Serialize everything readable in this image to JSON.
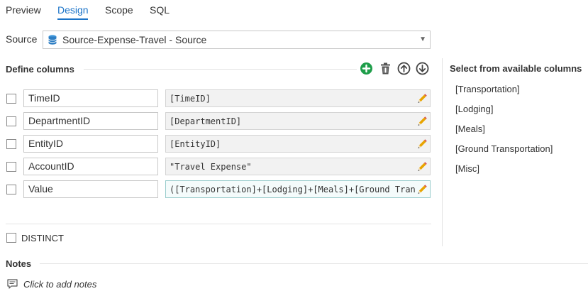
{
  "tabs": [
    {
      "label": "Preview",
      "active": false
    },
    {
      "label": "Design",
      "active": true
    },
    {
      "label": "Scope",
      "active": false
    },
    {
      "label": "SQL",
      "active": false
    }
  ],
  "source": {
    "label": "Source",
    "value": "Source-Expense-Travel - Source",
    "icon": "database-icon"
  },
  "define_columns": {
    "title": "Define columns",
    "toolbar": [
      "add-icon",
      "delete-icon",
      "move-up-icon",
      "move-down-icon"
    ],
    "rows": [
      {
        "checked": false,
        "name": "TimeID",
        "expression": "[TimeID]"
      },
      {
        "checked": false,
        "name": "DepartmentID",
        "expression": "[DepartmentID]"
      },
      {
        "checked": false,
        "name": "EntityID",
        "expression": "[EntityID]"
      },
      {
        "checked": false,
        "name": "AccountID",
        "expression": "\"Travel Expense\""
      },
      {
        "checked": false,
        "name": "Value",
        "expression": "([Transportation]+[Lodging]+[Meals]+[Ground Tran"
      }
    ]
  },
  "distinct": {
    "label": "DISTINCT",
    "checked": false
  },
  "available": {
    "title": "Select from available columns",
    "items": [
      "[Transportation]",
      "[Lodging]",
      "[Meals]",
      "[Ground Transportation]",
      "[Misc]"
    ]
  },
  "notes": {
    "title": "Notes",
    "placeholder": "Click to add notes"
  },
  "colors": {
    "accent": "#1a73c8",
    "add_button": "#1e9e4a",
    "pencil": "#e8a400"
  }
}
